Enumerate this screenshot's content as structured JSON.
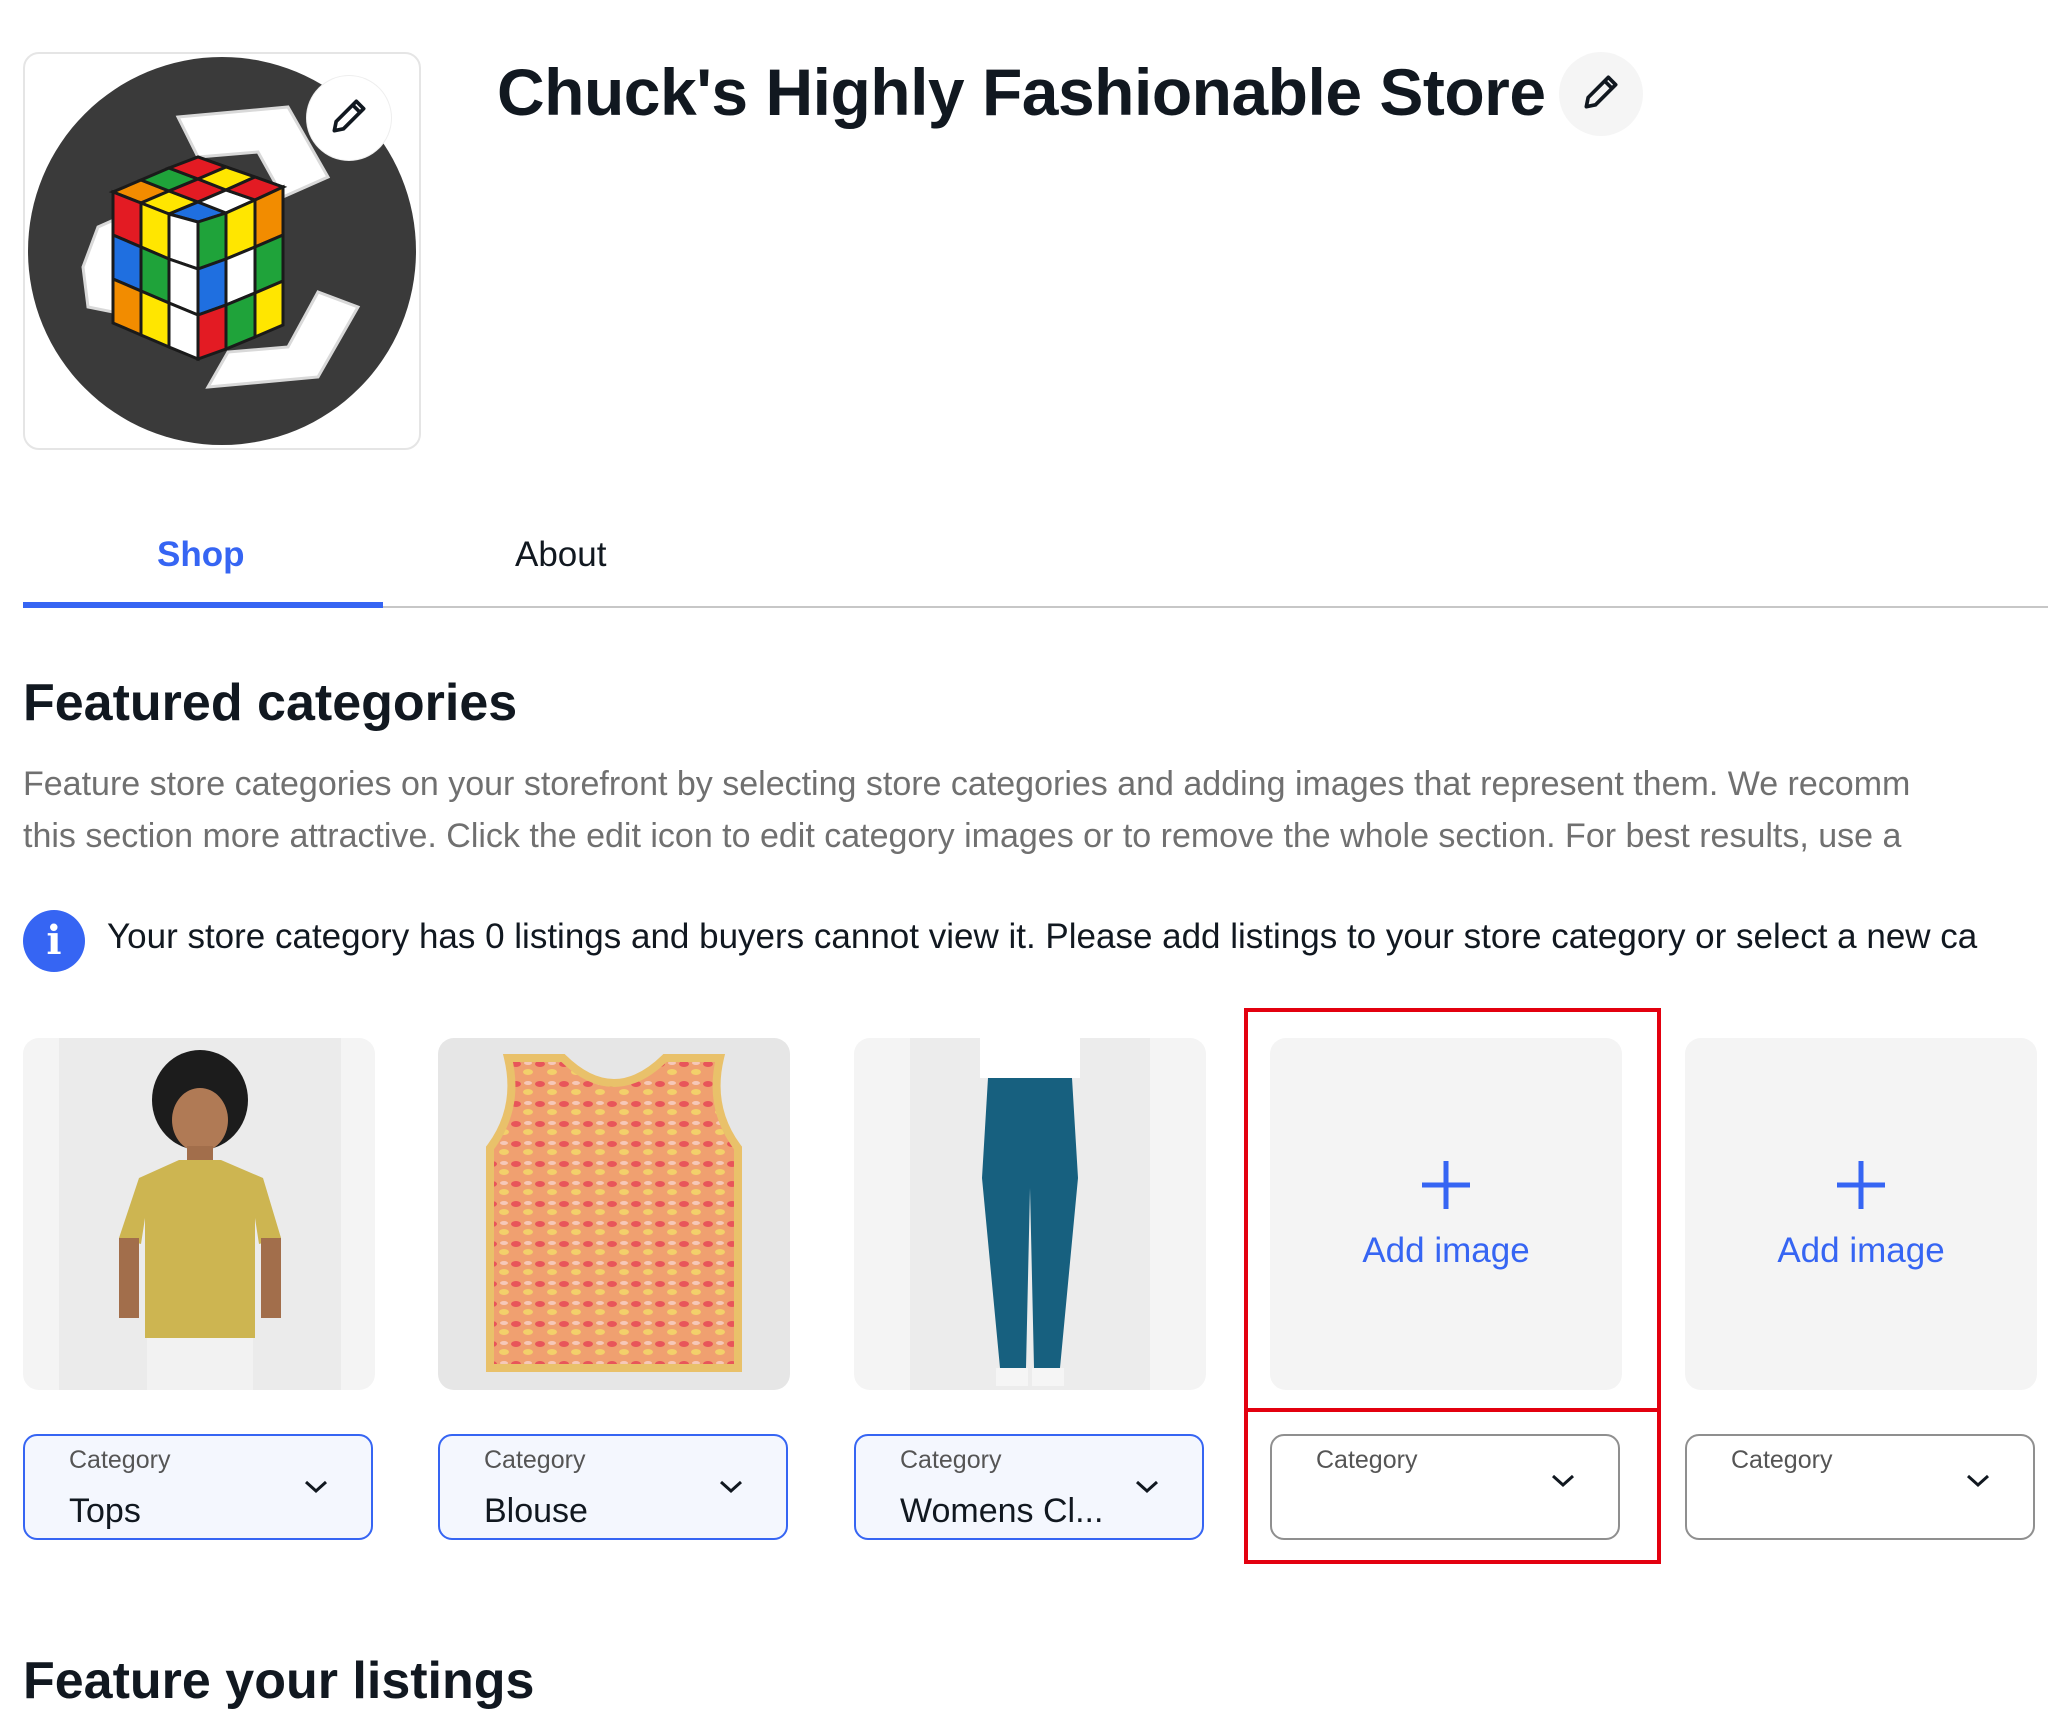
{
  "store": {
    "title": "Chuck's Highly Fashionable Store",
    "logo_icon": "rubiks-cube-recycle-logo",
    "edit_icon": "pencil-icon"
  },
  "tabs": [
    {
      "label": "Shop",
      "active": true
    },
    {
      "label": "About",
      "active": false
    }
  ],
  "featured": {
    "title": "Featured categories",
    "description_line1": "Feature store categories on your storefront by selecting store categories and adding images that represent them. We recomm",
    "description_line2": "this section more attractive. Click the edit icon to edit category images or to remove the whole section. For best results, use a",
    "info_message": "Your store category has 0 listings and buyers cannot view it. Please add listings to your store category or select a new ca",
    "add_image_label": "Add image",
    "categories": [
      {
        "label": "Category",
        "value": "Tops",
        "image": "yellow-tshirt-model"
      },
      {
        "label": "Category",
        "value": "Blouse",
        "image": "knit-vest-top"
      },
      {
        "label": "Category",
        "value": "Womens Cl...",
        "image": "teal-scrub-pants"
      },
      {
        "label": "Category",
        "value": "",
        "image": ""
      },
      {
        "label": "Category",
        "value": "",
        "image": ""
      }
    ]
  },
  "listings": {
    "title": "Feature your listings"
  },
  "colors": {
    "accent": "#3665f3",
    "highlight": "#e3000f"
  }
}
